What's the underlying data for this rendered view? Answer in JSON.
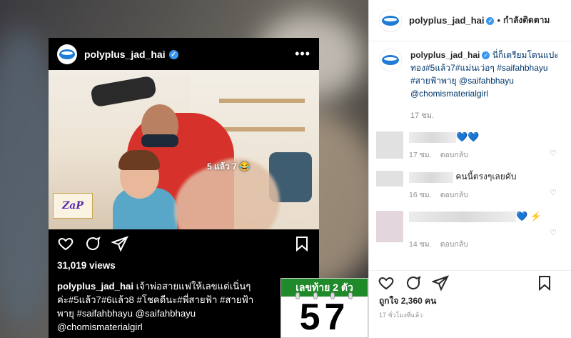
{
  "embed": {
    "username": "polyplus_jad_hai",
    "views": "31,019 views",
    "sticker": "5 แล้ว 7 😂",
    "badge_text": "ZaP",
    "caption_user": "polyplus_jad_hai",
    "caption_text": "เจ้าพ่อสายแฟให้เลขแต่เนิ่นๆ ค่ะ#5แล้ว7#6แล้ว8 #โชคดีนะ#พี่สายฟ้า #สายฟ้าพายุ #saifahbhayu @saifahbhayu @chomismaterialgirl"
  },
  "lotto": {
    "label": "เลขท้าย 2 ตัว",
    "number": "57"
  },
  "panel": {
    "username": "polyplus_jad_hai",
    "follow_status": "กำลังติดตาม",
    "caption_user": "polyplus_jad_hai",
    "caption_text": "นี่ก็เตรียมโดนแปะทอง#5แล้ว7#แม่นเว่อๆ #saifahbhayu #สายฟ้าพายุ @saifahbhayu @chomismaterialgirl",
    "caption_time": "17 ชม.",
    "comments": [
      {
        "text": "💙💙",
        "time": "17 ชม.",
        "reply": "ตอบกลับ"
      },
      {
        "text": "คนนี้ตรงๆเลยคับ",
        "time": "16 ชม.",
        "reply": "ตอบกลับ"
      },
      {
        "text": "💙 ⚡",
        "time": "14 ชม.",
        "reply": "ตอบกลับ"
      }
    ],
    "likes": "ถูกใจ 2,360 คน",
    "posted_ago": "17 ชั่วโมงที่แล้ว"
  },
  "colors": {
    "verified": "#3897f0",
    "lotto_green": "#1f8a2a",
    "brand_blue": "#1e7bd6"
  }
}
